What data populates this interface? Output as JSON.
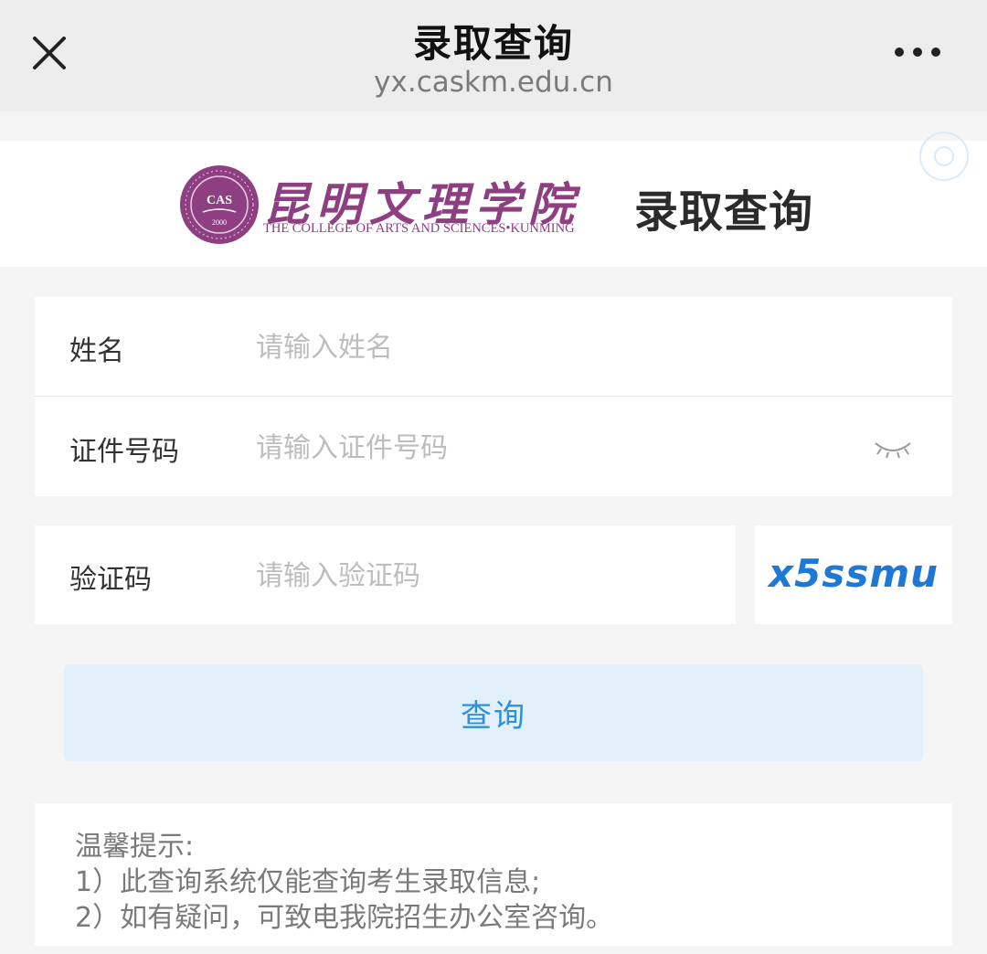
{
  "navbar": {
    "title": "录取查询",
    "url": "yx.caskm.edu.cn",
    "close_icon": "close-icon",
    "more_icon": "more-icon"
  },
  "banner": {
    "school_name_cn": "昆明文理学院",
    "school_name_en": "THE COLLEGE OF ARTS AND SCIENCES•KUNMING",
    "seal_text": "CAS",
    "seal_year": "2000",
    "page_title": "录取查询",
    "brand_color": "#8e3f82"
  },
  "form": {
    "name_label": "姓名",
    "name_placeholder": "请输入姓名",
    "id_label": "证件号码",
    "id_placeholder": "请输入证件号码",
    "captcha_label": "验证码",
    "captcha_placeholder": "请输入验证码",
    "captcha_code": "x5ssmu",
    "eye_icon": "eye-closed-icon"
  },
  "query_button": {
    "label": "查询",
    "accent_color": "#2f8fd8",
    "background_color": "#e1f0fb"
  },
  "tips": {
    "title": "温馨提示:",
    "lines": [
      "1）此查询系统仅能查询考生录取信息;",
      "2）如有疑问，可致电我院招生办公室咨询。"
    ]
  }
}
